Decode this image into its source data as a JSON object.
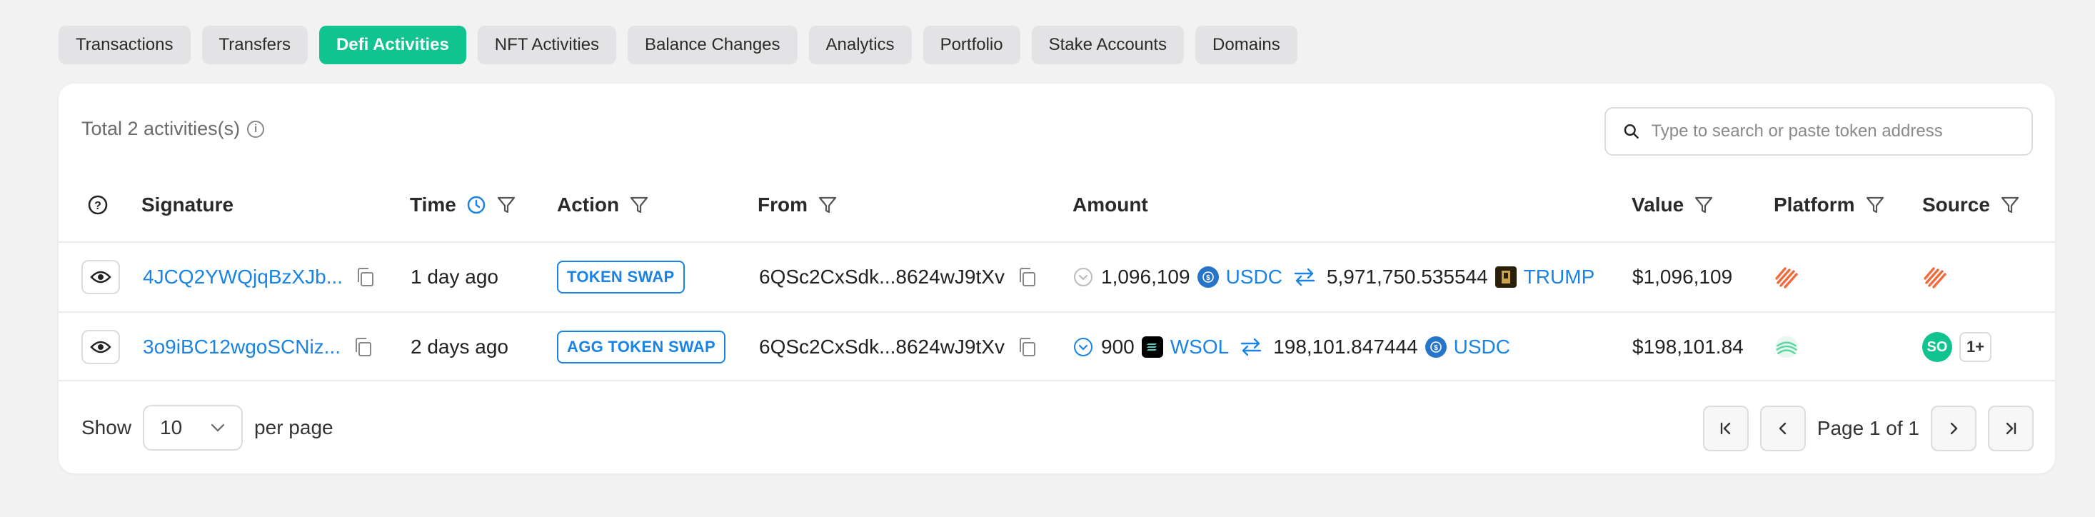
{
  "tabs": [
    "Transactions",
    "Transfers",
    "Defi Activities",
    "NFT Activities",
    "Balance Changes",
    "Analytics",
    "Portfolio",
    "Stake Accounts",
    "Domains"
  ],
  "active_tab": "Defi Activities",
  "summary": {
    "total_text": "Total 2 activities(s)"
  },
  "search": {
    "placeholder": "Type to search or paste token address"
  },
  "columns": {
    "signature": "Signature",
    "time": "Time",
    "action": "Action",
    "from": "From",
    "amount": "Amount",
    "value": "Value",
    "platform": "Platform",
    "source": "Source"
  },
  "rows": [
    {
      "signature": "4JCQ2YWQjqBzXJb...",
      "time": "1 day ago",
      "action": "TOKEN SWAP",
      "from": "6QSc2CxSdk...8624wJ9tXv",
      "amount_in": "1,096,109",
      "token_in": "USDC",
      "amount_out": "5,971,750.535544",
      "token_out": "TRUMP",
      "value": "$1,096,109"
    },
    {
      "signature": "3o9iBC12wgoSCNiz...",
      "time": "2 days ago",
      "action": "AGG TOKEN SWAP",
      "from": "6QSc2CxSdk...8624wJ9tXv",
      "amount_in": "900",
      "token_in": "WSOL",
      "amount_out": "198,101.847444",
      "token_out": "USDC",
      "value": "$198,101.84",
      "source_badge": "SO",
      "source_more": "1+"
    }
  ],
  "pagination": {
    "show_label": "Show",
    "per_page_value": "10",
    "per_page_label": "per page",
    "page_text": "Page 1 of 1"
  },
  "colors": {
    "accent": "#11c48f",
    "link": "#1a83e6",
    "usdc": "#2775ca"
  }
}
